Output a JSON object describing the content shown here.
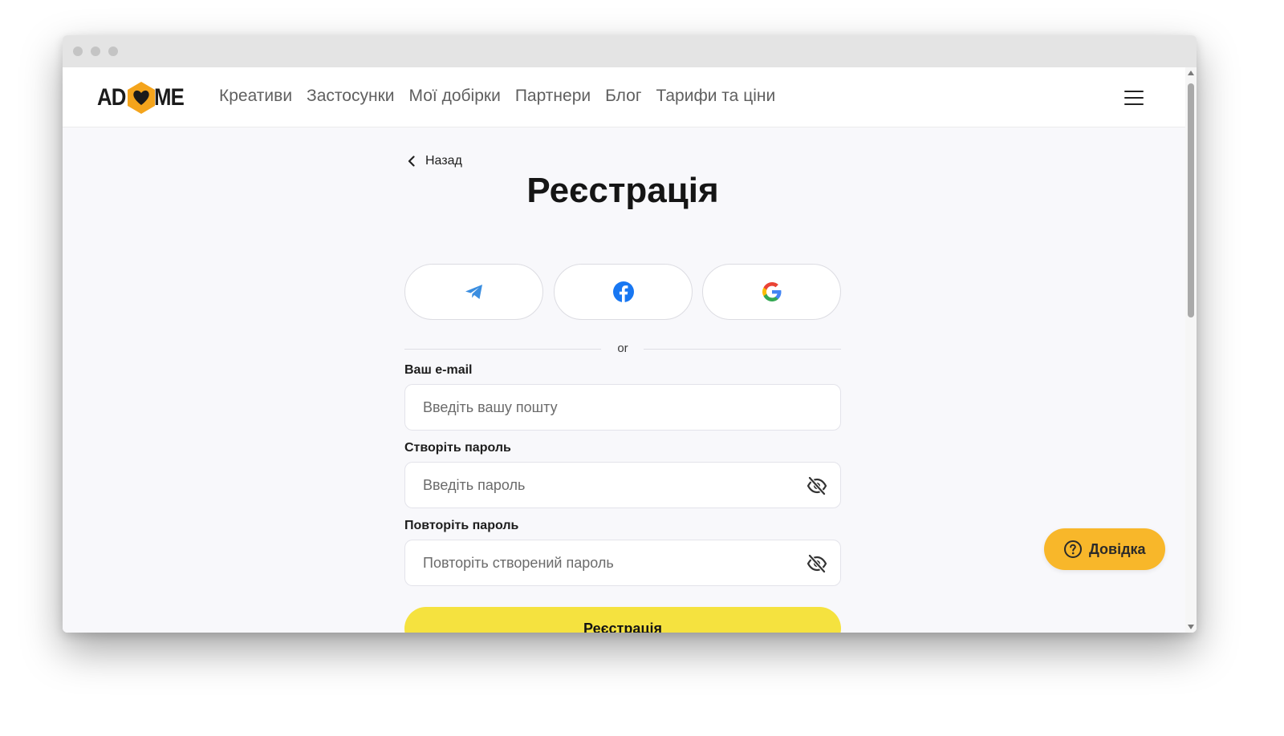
{
  "nav": {
    "logo": {
      "left": "AD",
      "right": "ME"
    },
    "links": [
      "Креативи",
      "Застосунки",
      "Мої добірки",
      "Партнери",
      "Блог",
      "Тарифи та ціни"
    ]
  },
  "page": {
    "back_label": "Назад",
    "title": "Реєстрація",
    "divider_text": "or"
  },
  "form": {
    "email_label": "Ваш e-mail",
    "email_placeholder": "Введіть вашу пошту",
    "password_label": "Створіть пароль",
    "password_placeholder": "Введіть пароль",
    "repeat_label": "Повторіть пароль",
    "repeat_placeholder": "Повторіть створений пароль",
    "submit_label": "Реєстрація"
  },
  "help": {
    "label": "Довідка"
  },
  "colors": {
    "accent_yellow": "#f5e23f",
    "help_orange": "#f8b72a",
    "logo_orange": "#f4a41c",
    "telegram_blue": "#3b8ee0",
    "facebook_blue": "#1877f2"
  }
}
